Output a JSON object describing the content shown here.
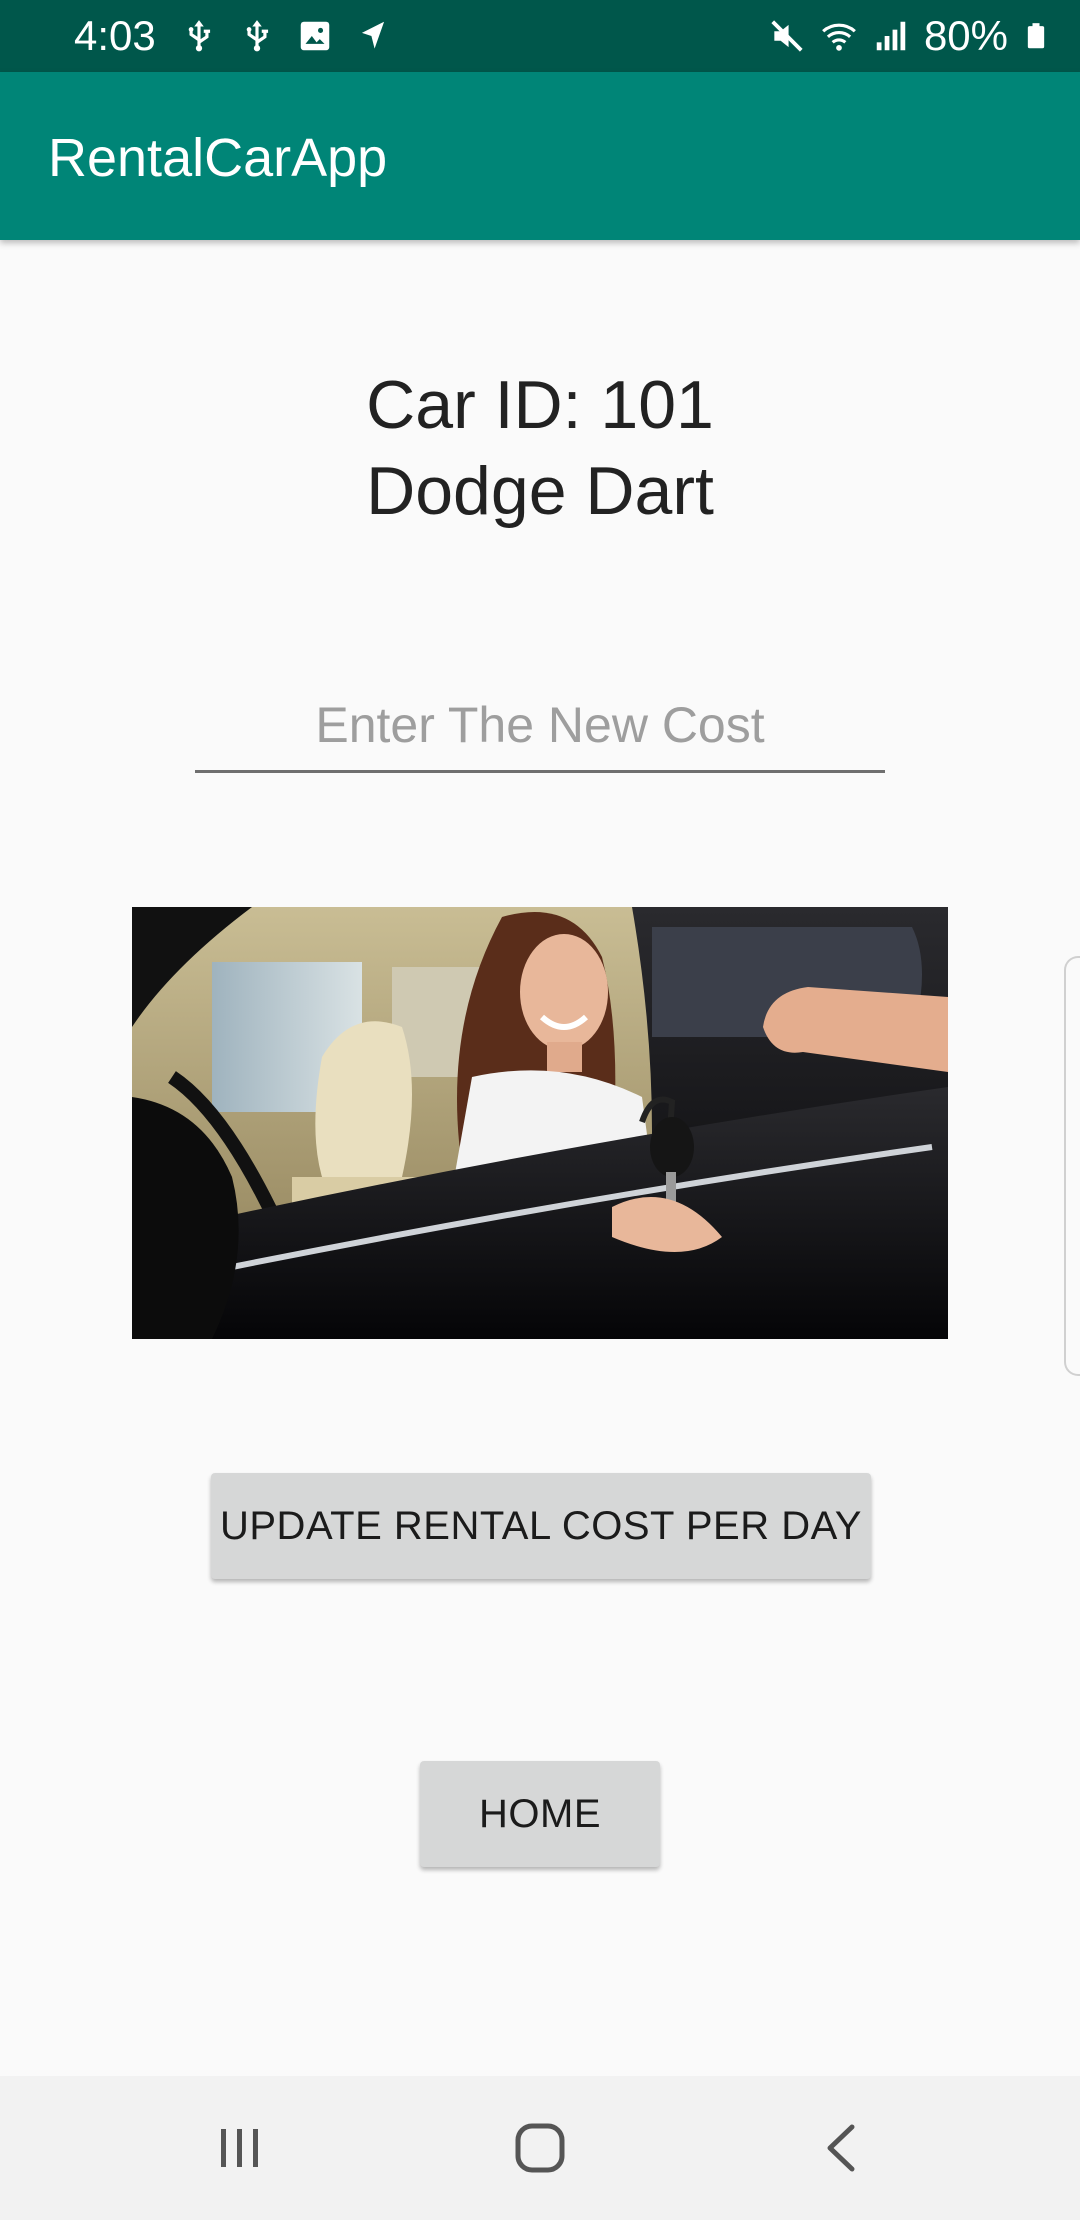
{
  "status_bar": {
    "time": "4:03",
    "battery": "80%",
    "left_icons": [
      "usb-icon",
      "usb-icon",
      "image-icon",
      "navigation-icon"
    ],
    "right_icons": [
      "mute-icon",
      "wifi-icon",
      "signal-icon",
      "battery-icon"
    ]
  },
  "app_bar": {
    "title": "RentalCarApp",
    "color": "#008577",
    "status_color": "#00574b"
  },
  "car": {
    "id_line": "Car ID: 101",
    "name": "Dodge Dart"
  },
  "cost_input": {
    "value": "",
    "placeholder": "Enter The New Cost"
  },
  "photo": {
    "description_icon": "car-keys-photo"
  },
  "buttons": {
    "update_label": "UPDATE RENTAL COST PER DAY",
    "home_label": "HOME"
  },
  "nav_bar": {
    "items": [
      "recents-icon",
      "home-icon",
      "back-icon"
    ]
  }
}
